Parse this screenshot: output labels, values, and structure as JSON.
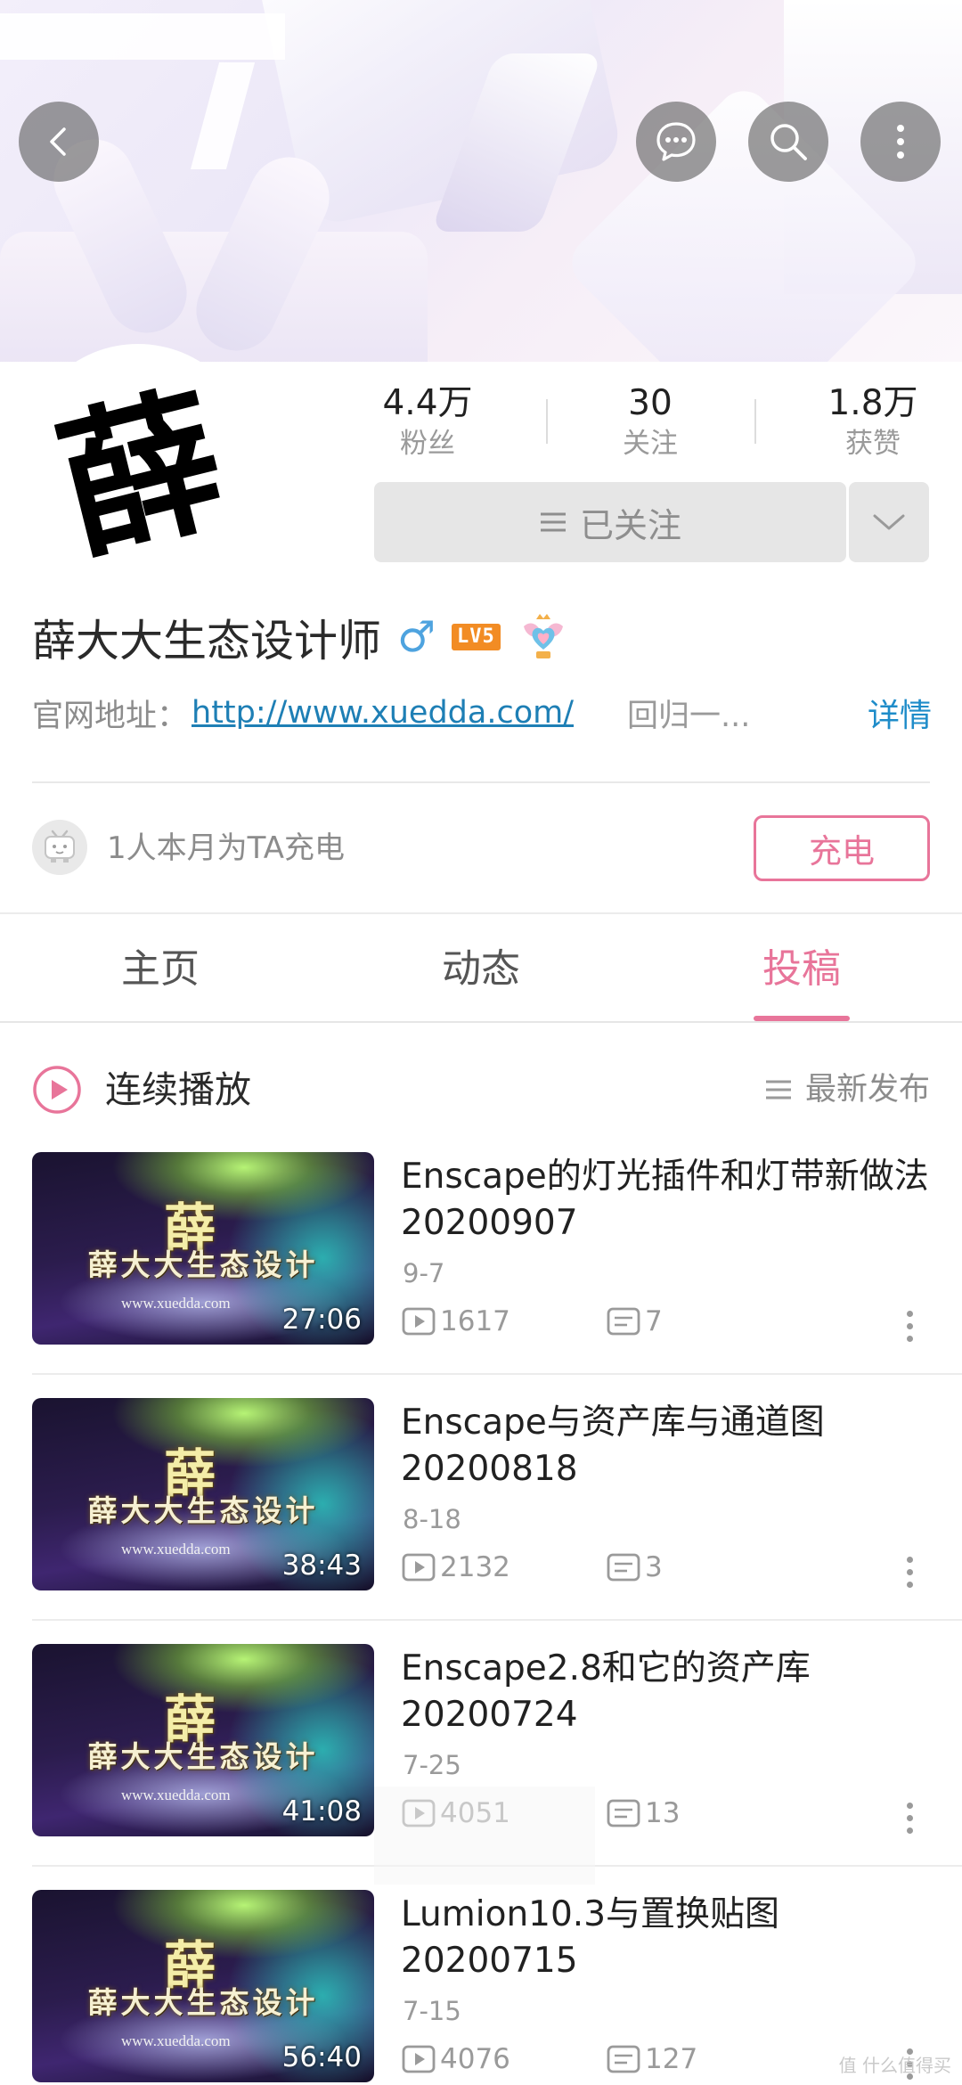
{
  "header": {
    "back_icon": "chevron-left-icon",
    "message_icon": "chat-bubble-icon",
    "search_icon": "search-icon",
    "more_icon": "more-vertical-icon"
  },
  "profile": {
    "avatar_char": "薛",
    "stats": [
      {
        "value": "4.4万",
        "label": "粉丝"
      },
      {
        "value": "30",
        "label": "关注"
      },
      {
        "value": "1.8万",
        "label": "获赞"
      }
    ],
    "follow_button": "已关注",
    "name": "薛大大生态设计师",
    "gender_symbol": "♂",
    "level": "LV5",
    "website_label": "官网地址：",
    "website_url": "http://www.xuedda.com/",
    "signature": "回归一...",
    "detail_link": "详情"
  },
  "charge": {
    "text": "1人本月为TA充电",
    "button": "充电"
  },
  "tabs": [
    "主页",
    "动态",
    "投稿"
  ],
  "active_tab": "投稿",
  "list_header": {
    "play_label": "连续播放",
    "sort_label": "最新发布"
  },
  "thumbnail": {
    "char": "薛",
    "title": "薛大大生态设计",
    "url": "www.xuedda.com"
  },
  "videos": [
    {
      "title": "Enscape的灯光插件和灯带新做法20200907",
      "date": "9-7",
      "duration": "27:06",
      "views": "1617",
      "comments": "7"
    },
    {
      "title": "Enscape与资产库与通道图20200818",
      "date": "8-18",
      "duration": "38:43",
      "views": "2132",
      "comments": "3"
    },
    {
      "title": "Enscape2.8和它的资产库20200724",
      "date": "7-25",
      "duration": "41:08",
      "views": "4051",
      "comments": "13"
    },
    {
      "title": "Lumion10.3与置换贴图20200715",
      "date": "7-15",
      "duration": "56:40",
      "views": "4076",
      "comments": "127"
    }
  ],
  "watermark": "值 什么值得买",
  "colors": {
    "accent_pink": "#e8759a",
    "link_blue": "#1e7fb5",
    "level_orange": "#f28c24",
    "gender_blue": "#4ea3df"
  }
}
